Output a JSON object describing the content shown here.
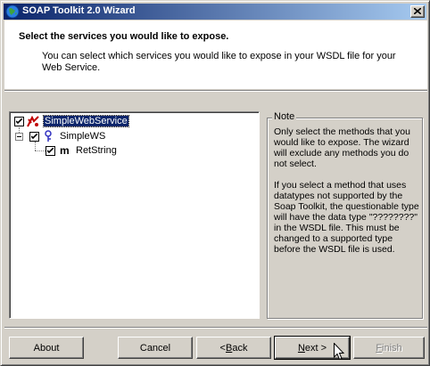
{
  "window": {
    "title": "SOAP Toolkit 2.0 Wizard",
    "close_icon": "close-icon"
  },
  "header": {
    "title": "Select the services you would like to expose.",
    "description": "You can select which services you would like to expose in your WSDL file for your Web Service."
  },
  "tree": {
    "items": [
      {
        "label": "SimpleWebService",
        "checked": true,
        "selected": true,
        "icon": "service-icon"
      },
      {
        "label": "SimpleWS",
        "checked": true,
        "selected": false,
        "icon": "port-icon"
      },
      {
        "label": "RetString",
        "checked": true,
        "selected": false,
        "icon": "method-icon",
        "icon_text": "m"
      }
    ]
  },
  "note": {
    "legend": "Note",
    "paragraph1": "Only select the methods that you would like to expose.  The wizard will exclude any methods you do not select.",
    "paragraph2": "If you select a method that uses datatypes not supported by the Soap Toolkit, the questionable type will have  the data type \"????????\" in the WSDL file.  This must be changed to a supported type before the WSDL file is used."
  },
  "buttons": {
    "about": "About",
    "cancel": "Cancel",
    "back": "< Back",
    "next": "Next >",
    "finish": "Finish"
  },
  "colors": {
    "titlebar_start": "#0a246a",
    "titlebar_end": "#a6caf0",
    "face": "#d4d0c8",
    "selection": "#0a246a"
  }
}
